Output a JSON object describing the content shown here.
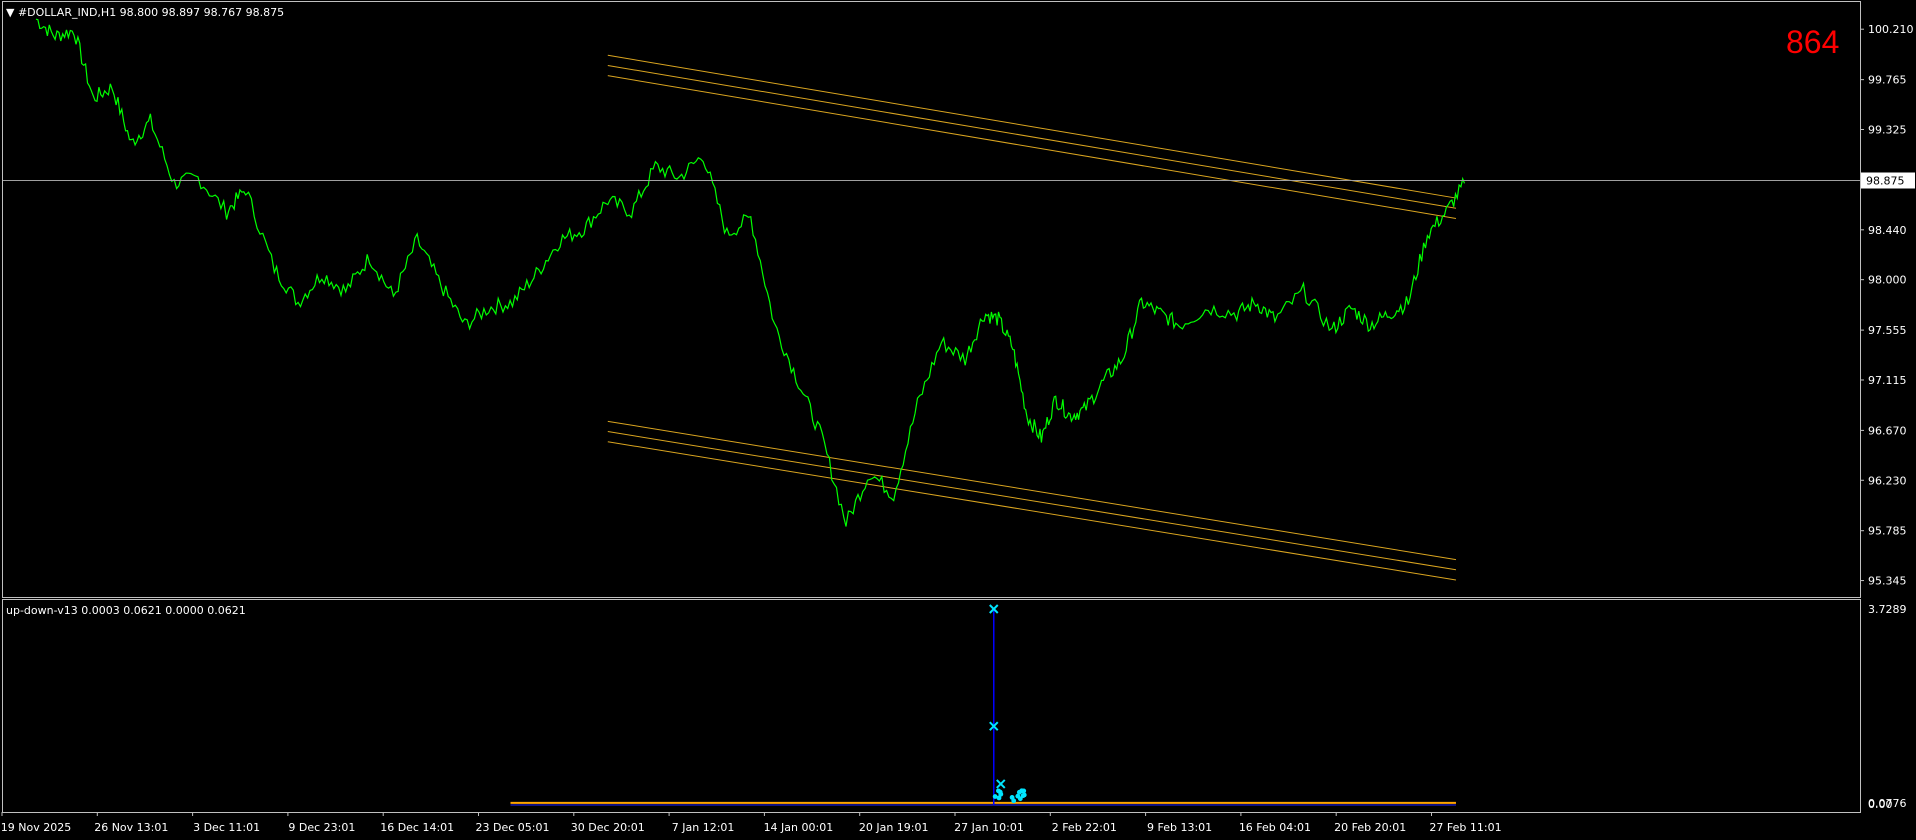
{
  "window": {
    "symbol_line": "▼ #DOLLAR_IND,H1  98.800 98.897 98.767 98.875",
    "counter": "864"
  },
  "indicator": {
    "title": "up-down-v13 0.0003 0.0621 0.0000 0.0621",
    "axis_labels": [
      "3.7289",
      "0.0776",
      "0.00"
    ],
    "spike_value": 3.7289,
    "mid_marker_value": 1.5,
    "baseline_value": 0.0776
  },
  "colors": {
    "background": "#000000",
    "price_line": "#00ff00",
    "channel": "#daa520",
    "indicator_line": "#0000ff",
    "indicator_marks": "#00e5ff",
    "indicator_base": "#ffa500",
    "counter": "#ff0000",
    "frame": "#c0c0c0"
  },
  "chart_data": {
    "type": "line",
    "title": "",
    "ylim": [
      95.2,
      100.45
    ],
    "y_ticks": [
      "100.210",
      "99.765",
      "99.325",
      "98.875",
      "98.440",
      "98.000",
      "97.555",
      "97.115",
      "96.670",
      "96.230",
      "95.785",
      "95.345"
    ],
    "current_price": "98.875",
    "x_ticks": [
      "19 Nov 2025",
      "26 Nov 13:01",
      "3 Dec 11:01",
      "9 Dec 23:01",
      "16 Dec 14:01",
      "23 Dec 05:01",
      "30 Dec 20:01",
      "7 Jan 12:01",
      "14 Jan 00:01",
      "20 Jan 19:01",
      "27 Jan 10:01",
      "2 Feb 22:01",
      "9 Feb 13:01",
      "16 Feb 04:01",
      "20 Feb 20:01",
      "27 Feb 11:01"
    ],
    "series": [
      {
        "x": [
          0,
          0.2,
          0.4,
          0.6,
          0.8,
          1.0,
          1.2,
          1.45,
          1.7,
          2.0,
          2.2,
          2.5,
          2.75,
          3.0,
          3.25,
          3.5,
          3.75,
          4.0,
          4.25,
          4.5,
          4.75,
          5.0,
          5.25,
          5.5,
          5.75,
          6.0,
          6.25,
          6.5,
          6.75,
          7.0,
          7.25,
          7.5,
          7.75,
          8.0,
          8.25,
          8.5,
          8.75,
          9.0,
          9.25,
          9.5,
          9.75,
          9.95,
          10.1,
          10.25,
          10.4,
          10.55,
          10.7,
          10.85,
          11.0,
          11.2,
          11.4,
          11.6,
          11.8,
          12.0,
          12.3,
          12.6,
          12.8,
          13.0,
          13.3,
          13.6,
          13.8,
          14.0,
          14.2,
          14.4,
          14.6,
          14.8,
          14.99
        ],
        "y": [
          100.3,
          100.15,
          100.2,
          99.6,
          99.7,
          99.2,
          99.4,
          98.85,
          98.9,
          98.6,
          98.8,
          98.1,
          97.8,
          98.05,
          97.9,
          98.2,
          97.85,
          98.35,
          97.95,
          97.6,
          97.75,
          97.8,
          98.05,
          98.35,
          98.45,
          98.7,
          98.6,
          99.0,
          98.9,
          99.1,
          98.4,
          98.55,
          97.6,
          97.1,
          96.6,
          95.85,
          96.3,
          96.1,
          96.9,
          97.45,
          97.3,
          97.7,
          97.65,
          97.4,
          96.8,
          96.6,
          96.95,
          96.8,
          96.85,
          97.1,
          97.3,
          97.8,
          97.7,
          97.6,
          97.75,
          97.7,
          97.8,
          97.65,
          97.9,
          97.55,
          97.75,
          97.6,
          97.7,
          97.8,
          98.4,
          98.6,
          98.85
        ]
      }
    ],
    "channel_upper": [
      {
        "x": [
          6.0,
          14.9
        ],
        "y": [
          99.98,
          98.72
        ]
      },
      {
        "x": [
          6.0,
          14.9
        ],
        "y": [
          99.89,
          98.63
        ]
      },
      {
        "x": [
          6.0,
          14.9
        ],
        "y": [
          99.8,
          98.54
        ]
      }
    ],
    "channel_lower": [
      {
        "x": [
          6.0,
          14.9
        ],
        "y": [
          96.75,
          95.53
        ]
      },
      {
        "x": [
          6.0,
          14.9
        ],
        "y": [
          96.66,
          95.44
        ]
      },
      {
        "x": [
          6.0,
          14.9
        ],
        "y": [
          96.57,
          95.35
        ]
      }
    ]
  }
}
